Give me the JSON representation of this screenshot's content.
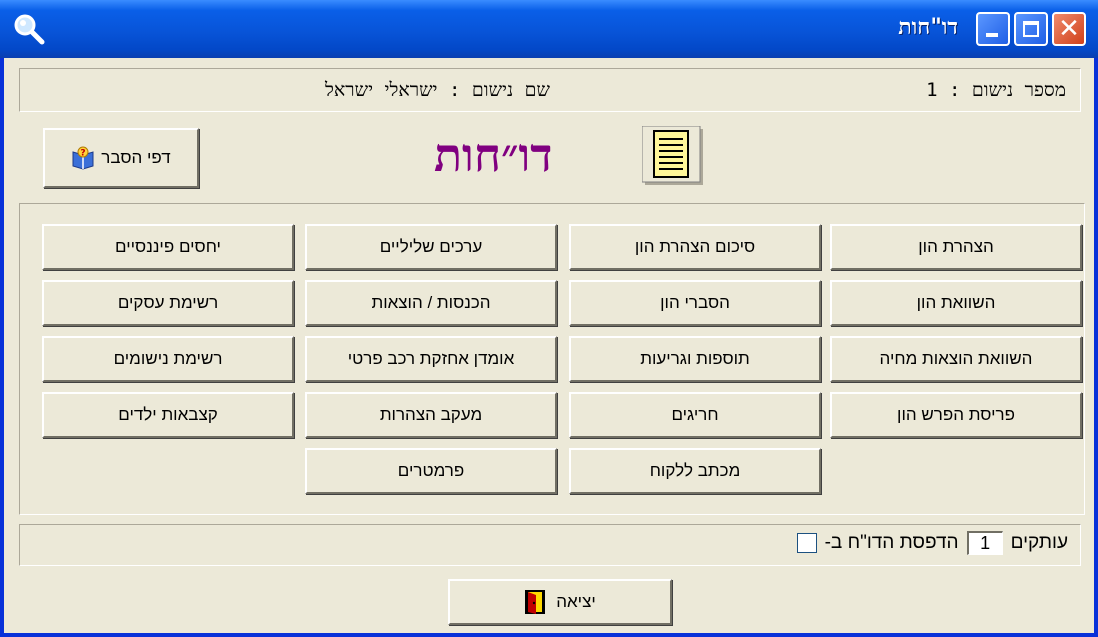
{
  "window": {
    "title": "דו\"חות"
  },
  "infobar": {
    "record_number": "מספר נישום : 1",
    "taxpayer_name": "שם נישום : ישראלי ישראל"
  },
  "header": {
    "title": "דו״חות",
    "help_button_label": "דפי הסבר"
  },
  "reports": {
    "col1": [
      "הצהרת הון",
      "השוואת הון",
      "השוואת הוצאות מחיה",
      "פריסת הפרש הון"
    ],
    "col2": [
      "סיכום הצהרת הון",
      "הסברי הון",
      "תוספות וגריעות",
      "חריגים",
      "מכתב ללקוח"
    ],
    "col3": [
      "ערכים שליליים",
      "הכנסות / הוצאות",
      "אומדן אחזקת רכב פרטי",
      "מעקב הצהרות",
      "פרמטרים"
    ],
    "col4": [
      "יחסים פיננסיים",
      "רשימת עסקים",
      "רשימת נישומים",
      "קצבאות ילדים"
    ]
  },
  "print": {
    "label": "הדפסת הדו\"ח ב-",
    "copies_value": "1",
    "copies_suffix": "עותקים",
    "checked": false
  },
  "footer": {
    "exit_label": "יציאה"
  },
  "colors": {
    "title_accent": "#800080",
    "window_face": "#ece9d8",
    "titlebar": "#0854d8"
  }
}
